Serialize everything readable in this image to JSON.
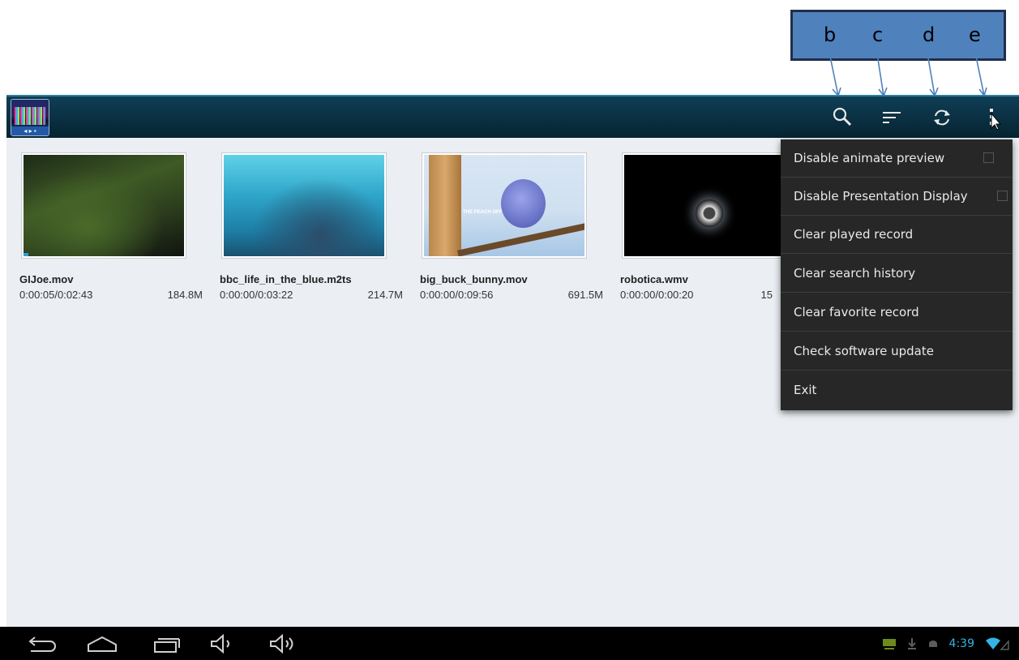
{
  "annotation": {
    "labels": [
      "b",
      "c",
      "d",
      "e"
    ],
    "box_color": "#4f81bd"
  },
  "actionbar": {
    "app_icon": "video-player-app-icon",
    "actions": [
      {
        "id": "search",
        "icon": "search-icon"
      },
      {
        "id": "sort",
        "icon": "sort-icon"
      },
      {
        "id": "refresh",
        "icon": "refresh-icon"
      },
      {
        "id": "overflow",
        "icon": "overflow-menu-icon"
      }
    ]
  },
  "videos": [
    {
      "name": "GIJoe.mov",
      "duration": "0:00:05/0:02:43",
      "size": "184.8M",
      "progress": 0.03
    },
    {
      "name": "bbc_life_in_the_blue.m2ts",
      "duration": "0:00:00/0:03:22",
      "size": "214.7M"
    },
    {
      "name": "big_buck_bunny.mov",
      "duration": "0:00:00/0:09:56",
      "size": "691.5M",
      "thumb_text": "THE PEACH OFF"
    },
    {
      "name": "robotica.wmv",
      "duration": "0:00:00/0:00:20",
      "size": "15"
    }
  ],
  "menu": {
    "items": [
      {
        "label": "Disable animate preview",
        "checkbox": true,
        "checked": false
      },
      {
        "label": "Disable Presentation Display",
        "checkbox": true,
        "checked": false
      },
      {
        "label": "Clear played record"
      },
      {
        "label": "Clear search history"
      },
      {
        "label": "Clear favorite record"
      },
      {
        "label": "Check software update"
      },
      {
        "label": "Exit"
      }
    ]
  },
  "navbar": {
    "buttons": [
      "back-icon",
      "home-icon",
      "recent-apps-icon",
      "volume-down-icon",
      "volume-up-icon"
    ],
    "status": {
      "time": "4:39",
      "icons": [
        "display-icon",
        "download-icon",
        "android-icon",
        "wifi-icon"
      ]
    }
  },
  "colors": {
    "accent": "#33b5e5",
    "actionbar": "#0f3e55",
    "menu_bg": "#272727"
  }
}
